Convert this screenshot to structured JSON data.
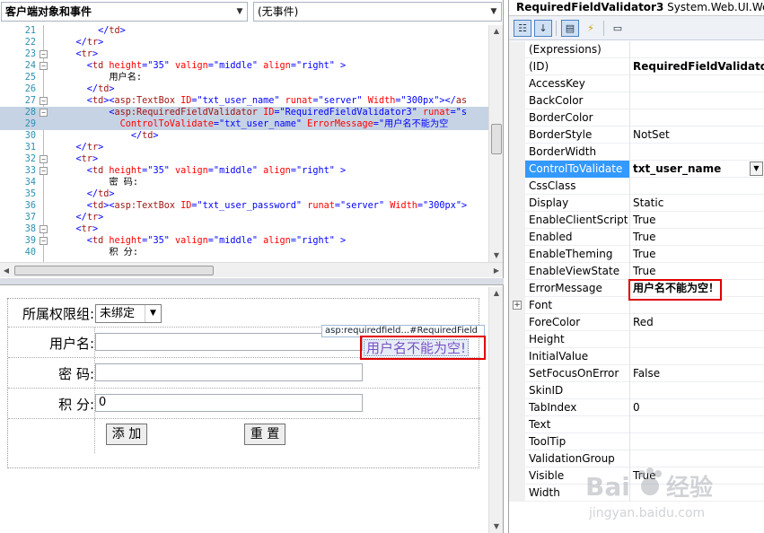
{
  "editor": {
    "objects_dropdown": "客户端对象和事件",
    "events_dropdown": "(无事件)",
    "lines": [
      {
        "n": "21",
        "fold": false,
        "sel": false,
        "html": "<span class=\"b\">        &lt;/</span><span class=\"k\">td</span><span class=\"b\">&gt;</span>"
      },
      {
        "n": "22",
        "fold": false,
        "sel": false,
        "html": "<span class=\"b\">    &lt;/</span><span class=\"k\">tr</span><span class=\"b\">&gt;</span>"
      },
      {
        "n": "23",
        "fold": true,
        "sel": false,
        "html": "<span class=\"b\">    &lt;</span><span class=\"k\">tr</span><span class=\"b\">&gt;</span>"
      },
      {
        "n": "24",
        "fold": true,
        "sel": false,
        "html": "<span class=\"b\">      &lt;</span><span class=\"k\">td</span> <span class=\"a\">height</span><span class=\"b\">=\"35\"</span> <span class=\"a\">valign</span><span class=\"b\">=\"middle\"</span> <span class=\"a\">align</span><span class=\"b\">=\"right\"</span> <span class=\"b\">&gt;</span>"
      },
      {
        "n": "25",
        "fold": false,
        "sel": false,
        "html": "<span class=\"t\">          用户名:</span>"
      },
      {
        "n": "26",
        "fold": false,
        "sel": false,
        "html": "<span class=\"b\">      &lt;/</span><span class=\"k\">td</span><span class=\"b\">&gt;</span>"
      },
      {
        "n": "27",
        "fold": true,
        "sel": false,
        "html": "<span class=\"b\">      &lt;</span><span class=\"k\">td</span><span class=\"b\">&gt;&lt;</span><span class=\"k\">asp:TextBox</span> <span class=\"a\">ID</span><span class=\"b\">=\"txt_user_name\"</span> <span class=\"a\">runat</span><span class=\"b\">=\"server\"</span> <span class=\"a\">Width</span><span class=\"b\">=\"300px\"&gt;&lt;/</span><span class=\"k\">as</span>"
      },
      {
        "n": "28",
        "fold": true,
        "sel": true,
        "html": "<span class=\"b\">          &lt;</span><span class=\"k\">asp:RequiredFieldValidator</span> <span class=\"a\">ID</span><span class=\"b\">=\"RequiredFieldValidator3\"</span> <span class=\"a\">runat</span><span class=\"b\">=\"s</span>"
      },
      {
        "n": "29",
        "fold": false,
        "sel": true,
        "html": "<span class=\"a\">            ControlToValidate</span><span class=\"b\">=\"txt_user_name\"</span> <span class=\"a\">ErrorMessage</span><span class=\"b\">=\"用户名不能为空</span>"
      },
      {
        "n": "30",
        "fold": false,
        "sel": false,
        "html": "<span class=\"b\">              &lt;/</span><span class=\"k\">td</span><span class=\"b\">&gt;</span>"
      },
      {
        "n": "31",
        "fold": false,
        "sel": false,
        "html": "<span class=\"b\">    &lt;/</span><span class=\"k\">tr</span><span class=\"b\">&gt;</span>"
      },
      {
        "n": "32",
        "fold": true,
        "sel": false,
        "html": "<span class=\"b\">    &lt;</span><span class=\"k\">tr</span><span class=\"b\">&gt;</span>"
      },
      {
        "n": "33",
        "fold": true,
        "sel": false,
        "html": "<span class=\"b\">      &lt;</span><span class=\"k\">td</span> <span class=\"a\">height</span><span class=\"b\">=\"35\"</span> <span class=\"a\">valign</span><span class=\"b\">=\"middle\"</span> <span class=\"a\">align</span><span class=\"b\">=\"right\"</span> <span class=\"b\">&gt;</span>"
      },
      {
        "n": "34",
        "fold": false,
        "sel": false,
        "html": "<span class=\"t\">          密 码:</span>"
      },
      {
        "n": "35",
        "fold": false,
        "sel": false,
        "html": "<span class=\"b\">      &lt;/</span><span class=\"k\">td</span><span class=\"b\">&gt;</span>"
      },
      {
        "n": "36",
        "fold": false,
        "sel": false,
        "html": "<span class=\"b\">      &lt;</span><span class=\"k\">td</span><span class=\"b\">&gt;&lt;</span><span class=\"k\">asp:TextBox</span> <span class=\"a\">ID</span><span class=\"b\">=\"txt_user_password\"</span> <span class=\"a\">runat</span><span class=\"b\">=\"server\"</span> <span class=\"a\">Width</span><span class=\"b\">=\"300px\"&gt;</span>"
      },
      {
        "n": "37",
        "fold": false,
        "sel": false,
        "html": "<span class=\"b\">    &lt;/</span><span class=\"k\">tr</span><span class=\"b\">&gt;</span>"
      },
      {
        "n": "38",
        "fold": true,
        "sel": false,
        "html": "<span class=\"b\">    &lt;</span><span class=\"k\">tr</span><span class=\"b\">&gt;</span>"
      },
      {
        "n": "39",
        "fold": true,
        "sel": false,
        "html": "<span class=\"b\">      &lt;</span><span class=\"k\">td</span> <span class=\"a\">height</span><span class=\"b\">=\"35\"</span> <span class=\"a\">valign</span><span class=\"b\">=\"middle\"</span> <span class=\"a\">align</span><span class=\"b\">=\"right\"</span> <span class=\"b\">&gt;</span>"
      },
      {
        "n": "40",
        "fold": false,
        "sel": false,
        "html": "<span class=\"t\">          积 分:</span>"
      }
    ]
  },
  "design": {
    "group_label": "所属权限组:",
    "group_select": "未绑定",
    "user_label": "用户名:",
    "password_label": "密 码:",
    "score_label": "积 分:",
    "score_value": "0",
    "add_button": "添 加",
    "reset_button": "重 置",
    "validator_tag": "asp:requiredfield...#RequiredField",
    "validator_text": "用户名不能为空!"
  },
  "props": {
    "object_name": "RequiredFieldValidator3",
    "object_type": "System.Web.UI.We",
    "rows": [
      {
        "name": "(Expressions)",
        "value": "",
        "expander": false,
        "bold": false
      },
      {
        "name": "(ID)",
        "value": "RequiredFieldValidator3",
        "expander": false,
        "bold": true
      },
      {
        "name": "AccessKey",
        "value": "",
        "expander": false,
        "bold": false
      },
      {
        "name": "BackColor",
        "value": "",
        "expander": false,
        "bold": false
      },
      {
        "name": "BorderColor",
        "value": "",
        "expander": false,
        "bold": false
      },
      {
        "name": "BorderStyle",
        "value": "NotSet",
        "expander": false,
        "bold": false
      },
      {
        "name": "BorderWidth",
        "value": "",
        "expander": false,
        "bold": false
      },
      {
        "name": "ControlToValidate",
        "value": "txt_user_name",
        "expander": false,
        "bold": true,
        "highlight": true,
        "dropdown": true
      },
      {
        "name": "CssClass",
        "value": "",
        "expander": false,
        "bold": false
      },
      {
        "name": "Display",
        "value": "Static",
        "expander": false,
        "bold": false
      },
      {
        "name": "EnableClientScript",
        "value": "True",
        "expander": false,
        "bold": false
      },
      {
        "name": "Enabled",
        "value": "True",
        "expander": false,
        "bold": false
      },
      {
        "name": "EnableTheming",
        "value": "True",
        "expander": false,
        "bold": false
      },
      {
        "name": "EnableViewState",
        "value": "True",
        "expander": false,
        "bold": false
      },
      {
        "name": "ErrorMessage",
        "value": "用户名不能为空！",
        "expander": false,
        "bold": true
      },
      {
        "name": "Font",
        "value": "",
        "expander": true,
        "bold": false
      },
      {
        "name": "ForeColor",
        "value": "Red",
        "expander": false,
        "bold": false
      },
      {
        "name": "Height",
        "value": "",
        "expander": false,
        "bold": false
      },
      {
        "name": "InitialValue",
        "value": "",
        "expander": false,
        "bold": false
      },
      {
        "name": "SetFocusOnError",
        "value": "False",
        "expander": false,
        "bold": false
      },
      {
        "name": "SkinID",
        "value": "",
        "expander": false,
        "bold": false
      },
      {
        "name": "TabIndex",
        "value": "0",
        "expander": false,
        "bold": false
      },
      {
        "name": "Text",
        "value": "",
        "expander": false,
        "bold": false
      },
      {
        "name": "ToolTip",
        "value": "",
        "expander": false,
        "bold": false
      },
      {
        "name": "ValidationGroup",
        "value": "",
        "expander": false,
        "bold": false
      },
      {
        "name": "Visible",
        "value": "True",
        "expander": false,
        "bold": false
      },
      {
        "name": "Width",
        "value": "",
        "expander": false,
        "bold": false
      }
    ]
  },
  "watermark": {
    "brand": "Bai",
    "brand_rest": "经验",
    "url": "jingyan.baidu.com"
  },
  "colors": {
    "highlight_red": "#e00000",
    "selection_blue": "#3399ff",
    "line_number": "#2b91af"
  }
}
